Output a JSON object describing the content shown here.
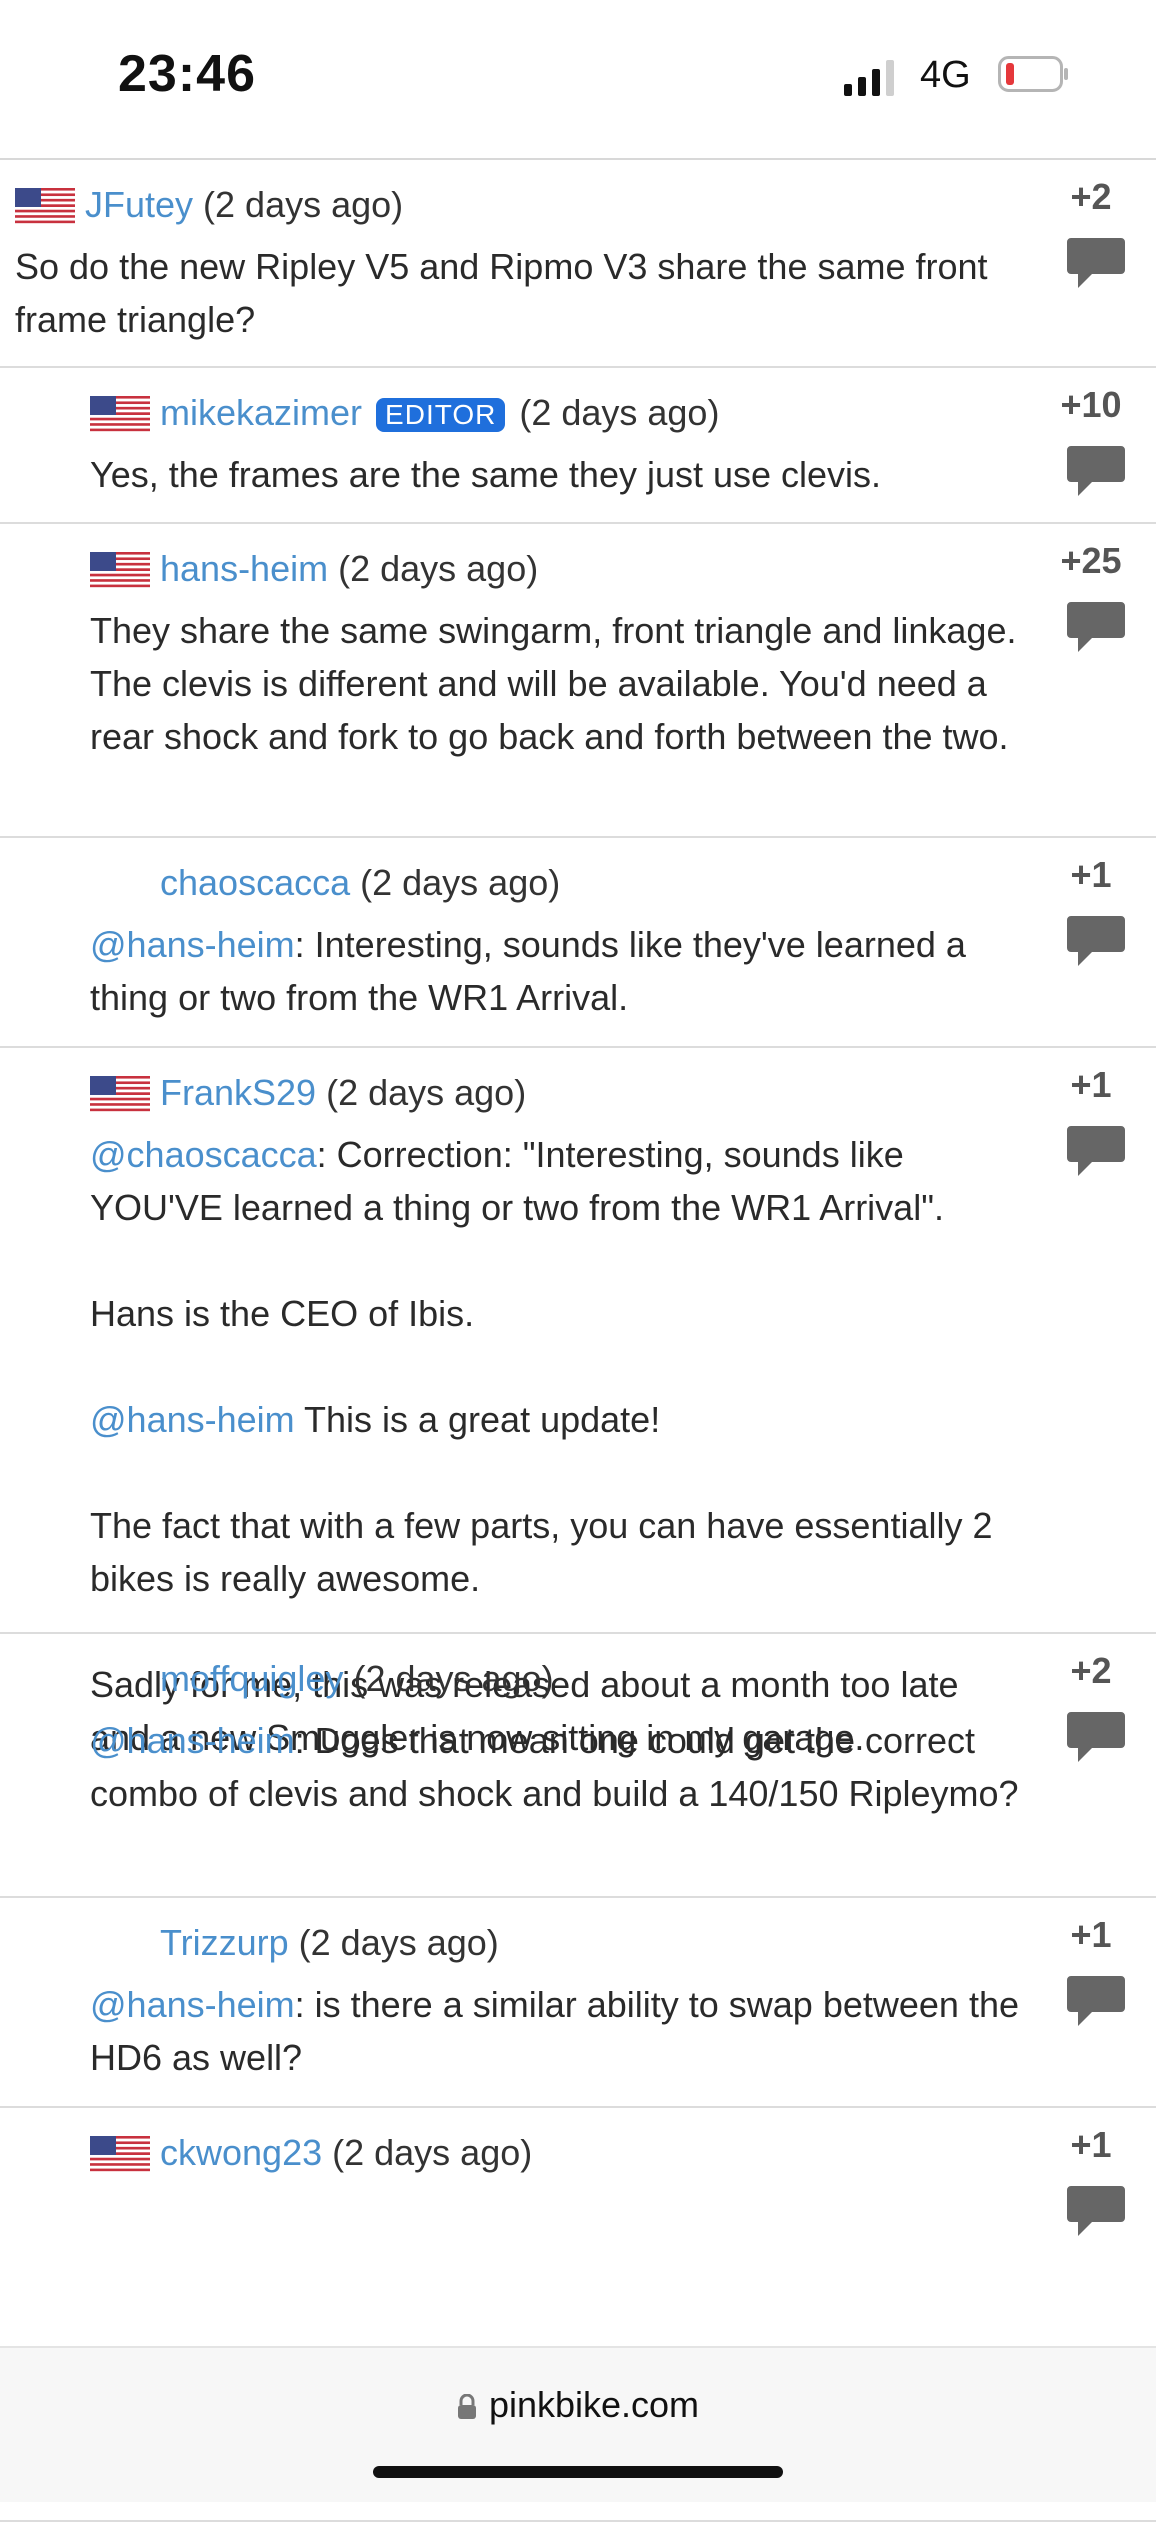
{
  "status": {
    "time": "23:46",
    "network": "4G"
  },
  "browser": {
    "url": "pinkbike.com"
  },
  "comments": [
    {
      "user": "JFutey",
      "flag": true,
      "editor": false,
      "time": " (2 days ago)",
      "score": "+2",
      "paragraphs": [
        {
          "mention": "",
          "text": "So do the new Ripley V5 and Ripmo V3 share the same front frame triangle?"
        }
      ]
    },
    {
      "user": "mikekazimer",
      "flag": true,
      "editor": true,
      "badge": "EDITOR",
      "time": " (2 days ago)",
      "score": "+10",
      "paragraphs": [
        {
          "mention": "",
          "text": "Yes, the frames are the same they just use clevis."
        }
      ]
    },
    {
      "user": "hans-heim",
      "flag": true,
      "editor": false,
      "time": " (2 days ago)",
      "score": "+25",
      "paragraphs": [
        {
          "mention": "",
          "text": "They share the same swingarm, front triangle and linkage. The clevis is different and will be available. You'd need a rear shock and fork to go back and forth between the two."
        }
      ]
    },
    {
      "user": "chaoscacca",
      "flag": false,
      "editor": false,
      "time": " (2 days ago)",
      "score": "+1",
      "paragraphs": [
        {
          "mention": "@hans-heim",
          "text": ": Interesting, sounds like they've learned a thing or two from the WR1 Arrival."
        }
      ]
    },
    {
      "user": "FrankS29",
      "flag": true,
      "editor": false,
      "time": " (2 days ago)",
      "score": "+1",
      "paragraphs": [
        {
          "mention": "@chaoscacca",
          "text": ": Correction: \"Interesting, sounds like YOU'VE learned a thing or two from the WR1 Arrival\"."
        },
        {
          "mention": "",
          "text": "Hans is the CEO of Ibis."
        },
        {
          "mention": "@hans-heim",
          "text": " This is a great update!"
        },
        {
          "mention": "",
          "text": "The fact that with a few parts, you can have essentially 2 bikes is really awesome."
        },
        {
          "mention": "",
          "text": "Sadly for me, this was released about a month too late and a new Smuggler is now sitting in my garage."
        }
      ]
    },
    {
      "user": "moffquigley",
      "flag": false,
      "editor": false,
      "time": " (2 days ago)",
      "score": "+2",
      "paragraphs": [
        {
          "mention": "@hans-heim",
          "text": ": Does that mean one could get the correct combo of clevis and shock and build a 140/150 Ripleymo?"
        }
      ]
    },
    {
      "user": "Trizzurp",
      "flag": false,
      "editor": false,
      "time": " (2 days ago)",
      "score": "+1",
      "paragraphs": [
        {
          "mention": "@hans-heim",
          "text": ": is there a similar ability to swap between the HD6 as well?"
        }
      ]
    },
    {
      "user": "ckwong23",
      "flag": true,
      "editor": false,
      "time": " (2 days ago)",
      "score": "+1",
      "paragraphs": []
    }
  ]
}
